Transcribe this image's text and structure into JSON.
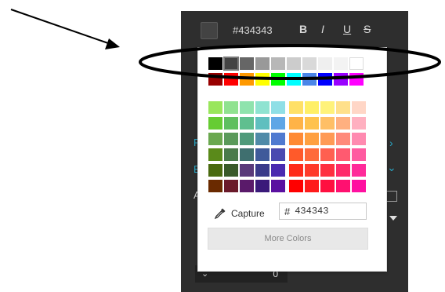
{
  "toolbar": {
    "swatch_color": "#434343",
    "hex_text": "#434343",
    "bold_label": "B",
    "italic_label": "I",
    "underline_label": "U",
    "strike_label": "S"
  },
  "side_labels": [
    "F",
    "E",
    "A"
  ],
  "stepper": {
    "value": "0"
  },
  "picker": {
    "selected_color": "#434343",
    "grays": [
      "#000000",
      "#434343",
      "#666666",
      "#999999",
      "#b7b7b7",
      "#cccccc",
      "#d9d9d9",
      "#efefef",
      "#f3f3f3",
      "#ffffff"
    ],
    "brights": [
      "#980000",
      "#ff0000",
      "#ff9900",
      "#ffff00",
      "#00ff00",
      "#00ffff",
      "#4a86e8",
      "#0000ff",
      "#9900ff",
      "#ff00ff"
    ],
    "grid_left": [
      [
        "#99e65c",
        "#8fe28f",
        "#8fe3ad",
        "#8fe3d1",
        "#8fdfe6"
      ],
      [
        "#66cc33",
        "#5fbf5f",
        "#5fbf8f",
        "#5fbfbf",
        "#5fa6e6"
      ],
      [
        "#6aa84f",
        "#5a9a5a",
        "#4f9a7a",
        "#4f8aa8",
        "#4f7ad0"
      ],
      [
        "#5a8a1a",
        "#4a7a4a",
        "#3f6f6f",
        "#3f5a9a",
        "#4a4ab0"
      ],
      [
        "#4a6a10",
        "#3a5a2a",
        "#5a3a7a",
        "#3a3a8a",
        "#4a2ab0"
      ],
      [
        "#6a2a00",
        "#6a1a2a",
        "#5a1a6a",
        "#3a1a7a",
        "#5a10a0"
      ]
    ],
    "grid_right": [
      [
        "#ffe066",
        "#ffef66",
        "#fff27a",
        "#ffe08a",
        "#ffd6c6"
      ],
      [
        "#ffb347",
        "#ffc24d",
        "#ffbf66",
        "#ffb080",
        "#ffb0c0"
      ],
      [
        "#ff8a33",
        "#ffa040",
        "#ff9a55",
        "#ff8a7a",
        "#ff8ab0"
      ],
      [
        "#ff5a2a",
        "#ff6a3a",
        "#ff6050",
        "#ff5a70",
        "#ff5aa0"
      ],
      [
        "#ff2a1a",
        "#ff3a2a",
        "#ff3040",
        "#ff2a6a",
        "#ff2a9a"
      ],
      [
        "#ff0000",
        "#ff1a1a",
        "#ff1040",
        "#ff1070",
        "#ff10a0"
      ]
    ],
    "capture_label": "Capture",
    "hex_prefix": "#",
    "hex_value": "434343",
    "more_colors_label": "More Colors"
  }
}
